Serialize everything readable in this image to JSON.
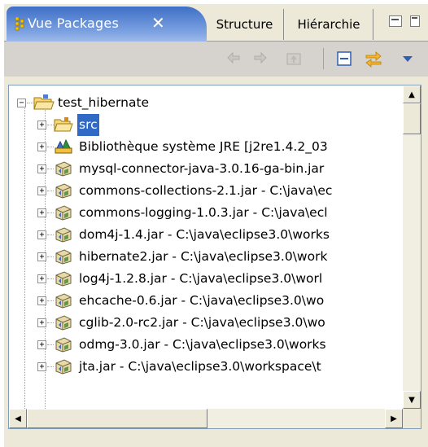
{
  "tabs": {
    "active": {
      "label": "Vue Packages",
      "icon": "packages-icon",
      "close": "✕"
    },
    "others": [
      {
        "label": "Structure"
      },
      {
        "label": "Hiérarchie"
      }
    ]
  },
  "toolbar": {
    "buttons": [
      "back-arrow-icon",
      "forward-arrow-icon",
      "up-folder-icon",
      "collapse-all-icon",
      "link-with-editor-icon",
      "view-menu-icon"
    ]
  },
  "tree": {
    "project": {
      "label": "test_hibernate",
      "icon": "project-folder-icon",
      "expanded": true
    },
    "children": [
      {
        "label": "src",
        "icon": "source-folder-icon",
        "selected": true
      },
      {
        "label": "Bibliothèque système JRE [j2re1.4.2_03",
        "icon": "library-icon"
      },
      {
        "label": "mysql-connector-java-3.0.16-ga-bin.jar",
        "icon": "jar-icon"
      },
      {
        "label": "commons-collections-2.1.jar - C:\\java\\ec",
        "icon": "jar-icon"
      },
      {
        "label": "commons-logging-1.0.3.jar - C:\\java\\ecl",
        "icon": "jar-icon"
      },
      {
        "label": "dom4j-1.4.jar - C:\\java\\eclipse3.0\\works",
        "icon": "jar-icon"
      },
      {
        "label": "hibernate2.jar - C:\\java\\eclipse3.0\\work",
        "icon": "jar-icon"
      },
      {
        "label": "log4j-1.2.8.jar - C:\\java\\eclipse3.0\\worl",
        "icon": "jar-icon"
      },
      {
        "label": "ehcache-0.6.jar - C:\\java\\eclipse3.0\\wo",
        "icon": "jar-icon"
      },
      {
        "label": "cglib-2.0-rc2.jar - C:\\java\\eclipse3.0\\wo",
        "icon": "jar-icon"
      },
      {
        "label": "odmg-3.0.jar - C:\\java\\eclipse3.0\\works",
        "icon": "jar-icon"
      },
      {
        "label": "jta.jar - C:\\java\\eclipse3.0\\workspace\\t",
        "icon": "jar-icon"
      }
    ]
  },
  "colors": {
    "active_tab": "#3e6fc6",
    "selection": "#316ac5",
    "toolbar": "#d6d3ce",
    "chrome": "#ece9d8"
  }
}
